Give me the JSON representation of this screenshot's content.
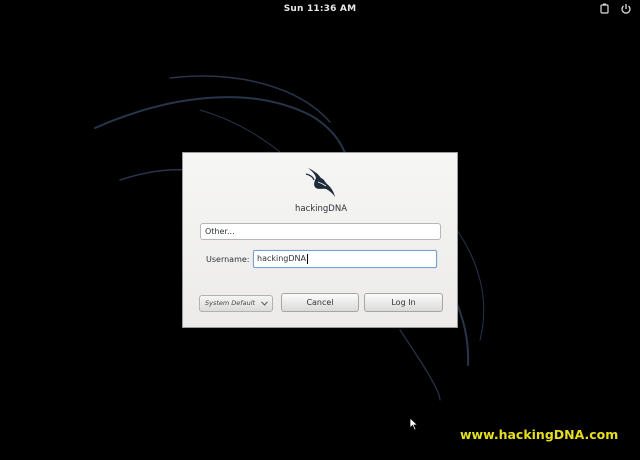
{
  "topbar": {
    "clock": "Sun 11:36 AM",
    "icons": [
      "accessibility-icon",
      "power-icon"
    ]
  },
  "dialog": {
    "hostname": "hackingDNA",
    "user_list_item": "Other...",
    "username_label": "Username:",
    "username_value": "hackingDNA",
    "session_label": "System Default",
    "cancel_label": "Cancel",
    "login_label": "Log In"
  },
  "watermark": "www.hackingDNA.com"
}
